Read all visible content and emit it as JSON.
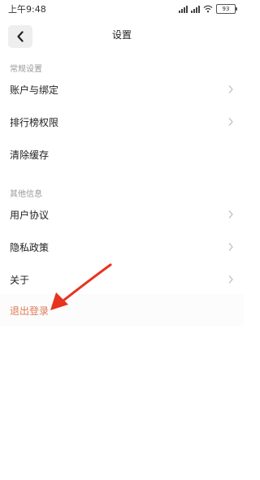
{
  "status_bar": {
    "time": "上午9:48",
    "battery": "93"
  },
  "header": {
    "title": "设置"
  },
  "sections": [
    {
      "header": "常规设置",
      "items": [
        {
          "label": "账户与绑定",
          "chevron": true
        },
        {
          "label": "排行榜权限",
          "chevron": true
        },
        {
          "label": "清除缓存",
          "chevron": false
        }
      ]
    },
    {
      "header": "其他信息",
      "items": [
        {
          "label": "用户协议",
          "chevron": true
        },
        {
          "label": "隐私政策",
          "chevron": true
        },
        {
          "label": "关于",
          "chevron": true
        }
      ]
    }
  ],
  "logout": {
    "label": "退出登录",
    "color": "#e07a52"
  },
  "annotation": {
    "arrow_color": "#e8331e"
  }
}
